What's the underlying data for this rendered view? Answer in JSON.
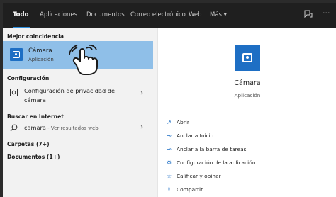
{
  "colors": {
    "accent": "#1e6fc4",
    "selected_bg": "#8fbfe8",
    "topbar_bg": "#1f1f1f"
  },
  "tabs": {
    "all": "Todo",
    "apps": "Aplicaciones",
    "docs": "Documentos",
    "email": "Correo electrónico",
    "web": "Web",
    "more": "Más ▾"
  },
  "left": {
    "best_match_header": "Mejor coincidencia",
    "best_match": {
      "title": "Cámara",
      "subtitle": "Aplicación",
      "icon": "camera-icon"
    },
    "settings_header": "Configuración",
    "settings_item": {
      "line1": "Configuración de privacidad de",
      "line2": "cámara",
      "icon": "privacy-camera-icon"
    },
    "internet_header": "Buscar en Internet",
    "web_item": {
      "query": "camara",
      "hint": " - Ver resultados web",
      "icon": "search-icon"
    },
    "folders": "Carpetas (7+)",
    "documents": "Documentos (1+)"
  },
  "right": {
    "app_name": "Cámara",
    "app_type": "Aplicación",
    "actions": [
      {
        "label": "Abrir",
        "icon": "open-icon"
      },
      {
        "label": "Anclar a Inicio",
        "icon": "pin-icon"
      },
      {
        "label": "Anclar a la barra de tareas",
        "icon": "pin-icon"
      },
      {
        "label": "Configuración de la aplicación",
        "icon": "gear-icon"
      },
      {
        "label": "Calificar y opinar",
        "icon": "rate-icon"
      },
      {
        "label": "Compartir",
        "icon": "share-icon"
      }
    ]
  }
}
